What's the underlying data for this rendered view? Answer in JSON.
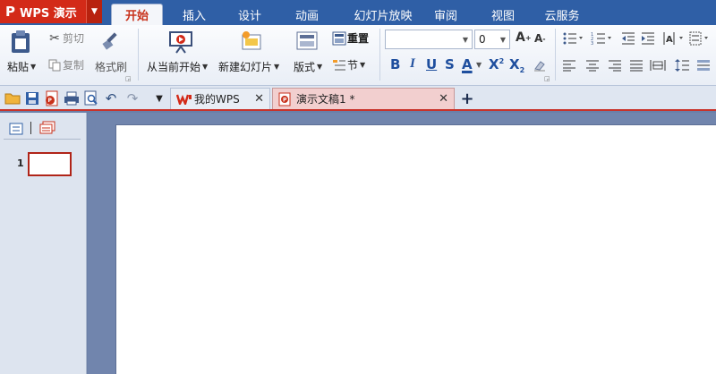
{
  "app": {
    "name": "WPS 演示",
    "logo": "P"
  },
  "menu_tabs": [
    "开始",
    "插入",
    "设计",
    "动画",
    "幻灯片放映",
    "审阅",
    "视图",
    "云服务"
  ],
  "active_tab": "开始",
  "ribbon": {
    "paste": "粘贴",
    "cut": "剪切",
    "copy": "复制",
    "format_painter": "格式刷",
    "from_current": "从当前开始",
    "new_slide": "新建幻灯片",
    "layout": "版式",
    "reset": "重置",
    "section": "节",
    "font_name": "",
    "font_size": "0"
  },
  "doc_tabs": [
    {
      "label": "我的WPS"
    },
    {
      "label": "演示文稿1 *"
    }
  ],
  "slides": {
    "thumb_number": "1"
  },
  "colors": {
    "accent_red": "#d32a18",
    "tab_blue": "#2f5fa6",
    "format_blue": "#1f4f9e"
  }
}
